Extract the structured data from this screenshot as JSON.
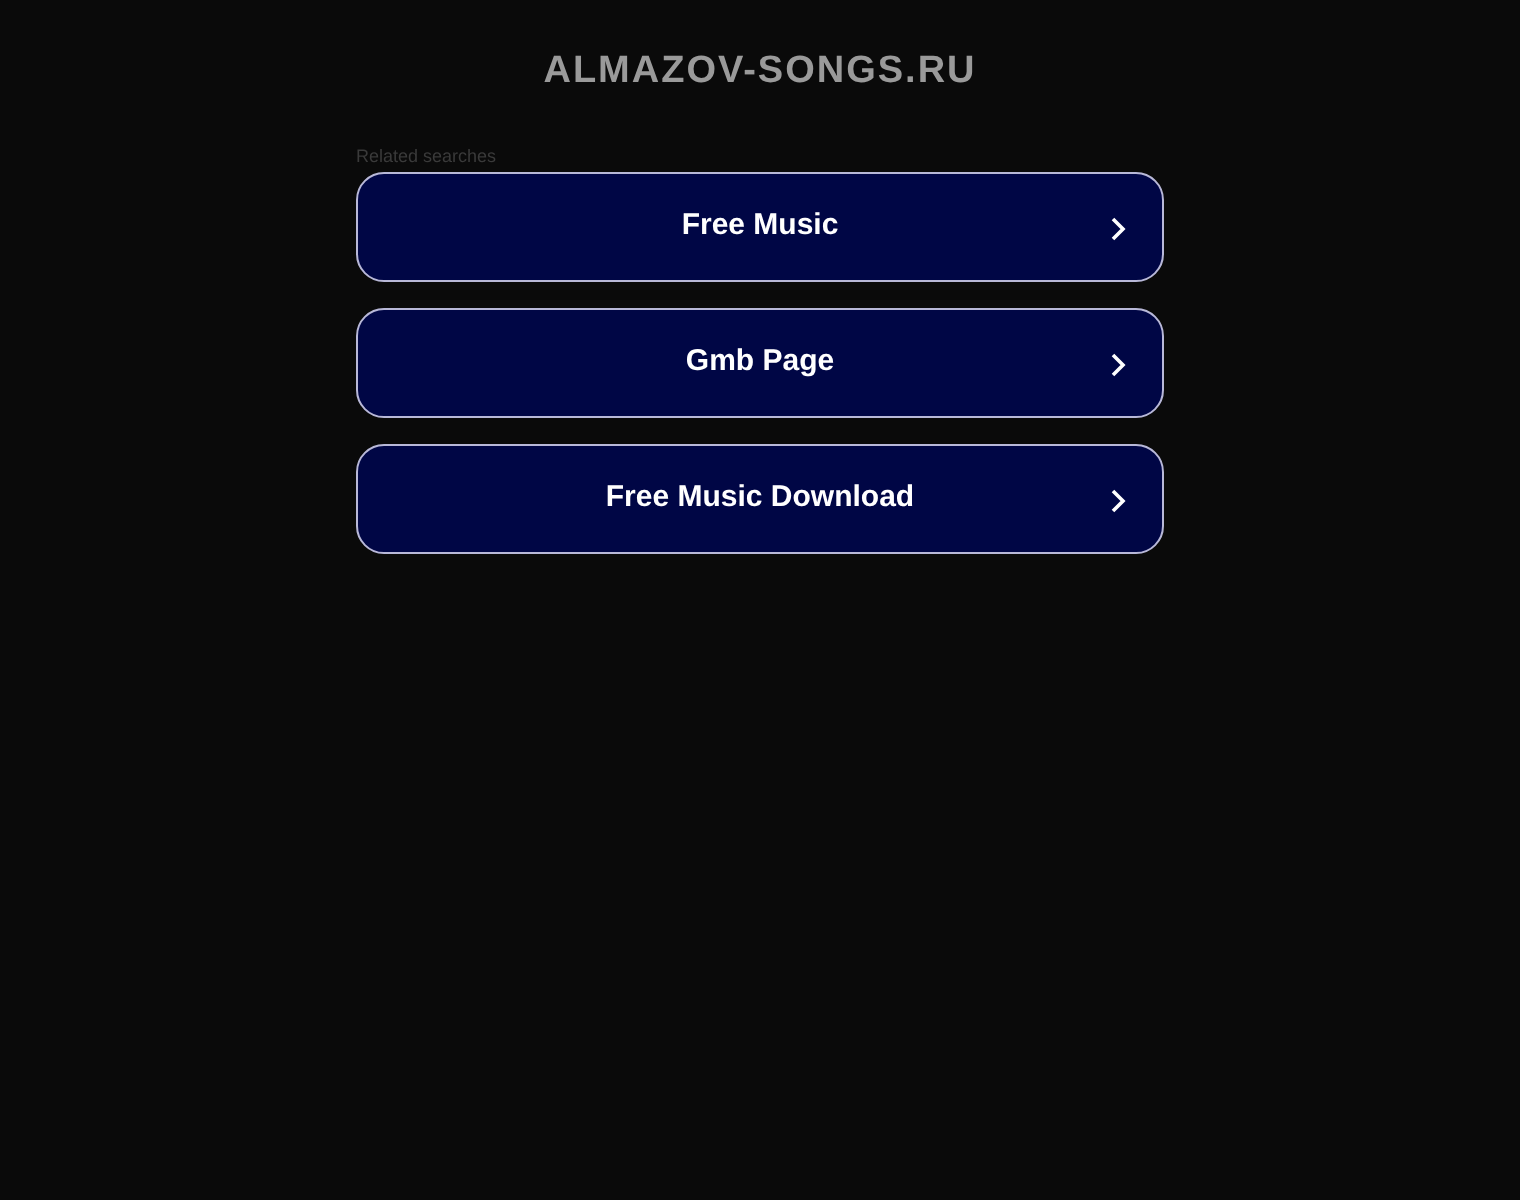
{
  "site_title": "ALMAZOV-SONGS.RU",
  "related_searches": {
    "heading": "Related searches",
    "links": [
      {
        "label": "Free Music"
      },
      {
        "label": "Gmb Page"
      },
      {
        "label": "Free Music Download"
      }
    ]
  }
}
